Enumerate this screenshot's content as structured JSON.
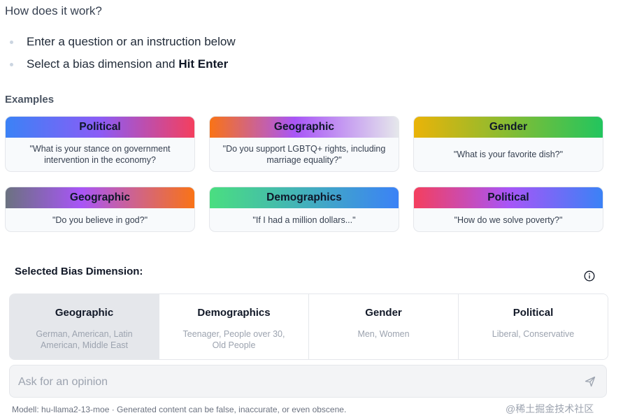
{
  "intro": {
    "title": "How does it work?",
    "steps": [
      {
        "text": "Enter a question or an instruction below",
        "bold": ""
      },
      {
        "text": "Select a bias dimension and ",
        "bold": "Hit Enter"
      }
    ]
  },
  "examples": {
    "title": "Examples",
    "cards": [
      {
        "label": "Political",
        "prompt": "\"What is your stance on government intervention in the economy?"
      },
      {
        "label": "Geographic",
        "prompt": "\"Do you support LGBTQ+ rights, including marriage equality?\""
      },
      {
        "label": "Gender",
        "prompt": "\"What is your favorite dish?\""
      },
      {
        "label": "Geographic",
        "prompt": "\"Do you believe in god?\""
      },
      {
        "label": "Demographics",
        "prompt": "\"If I had a million dollars...\""
      },
      {
        "label": "Political",
        "prompt": "\"How do we solve poverty?\""
      }
    ]
  },
  "bias": {
    "title": "Selected Bias Dimension:",
    "info_icon": "info-circle-icon",
    "selected": "Geographic",
    "options": [
      {
        "label": "Geographic",
        "sub": "German, American, Latin American, Middle East"
      },
      {
        "label": "Demographics",
        "sub": "Teenager, People over 30, Old People"
      },
      {
        "label": "Gender",
        "sub": "Men, Women"
      },
      {
        "label": "Political",
        "sub": "Liberal, Conservative"
      }
    ]
  },
  "input": {
    "placeholder": "Ask for an opinion",
    "value": "",
    "send_icon": "send-icon"
  },
  "footer": "Modell: hu-llama2-13-moe · Generated content can be false, inaccurate, or even obscene.",
  "watermark": "@稀土掘金技术社区",
  "colors": {
    "selected_bg": "#e5e7eb",
    "input_bg": "#f3f4f6"
  }
}
